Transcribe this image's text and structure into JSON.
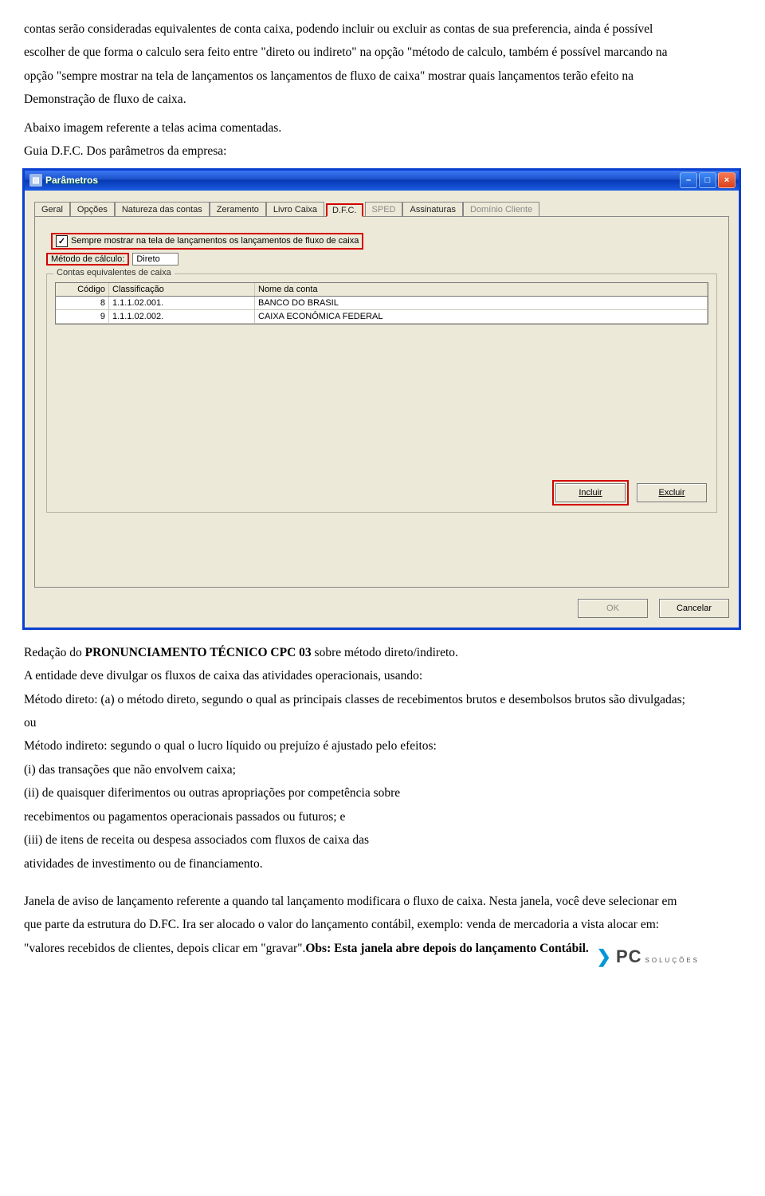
{
  "text": {
    "p1": "contas serão consideradas equivalentes de conta caixa, podendo incluir ou excluir as contas de sua preferencia, ainda é possível escolher de que forma o calculo sera feito entre \"direto ou indireto\" na opção \"método de calculo, também é possível marcando na opção \"sempre mostrar na tela  de lançamentos os lançamentos de fluxo de caixa\" mostrar quais lançamentos terão efeito na Demonstração de fluxo de caixa.",
    "p2": "Abaixo imagem referente a telas acima comentadas.",
    "p3": "Guia D.F.C. Dos parâmetros da empresa:",
    "p4a": "Redação do ",
    "p4b": "PRONUNCIAMENTO TÉCNICO CPC 03",
    "p4c": " sobre método direto/indireto.",
    "p5": "A entidade deve divulgar os fluxos de caixa das atividades operacionais, usando:",
    "p6": "Método direto: (a) o método direto, segundo o qual as principais classes de recebimentos brutos e desembolsos brutos são divulgadas; ou",
    "p7": "Método indireto: segundo o qual o lucro líquido ou prejuízo é ajustado pelo efeitos:",
    "p8": "(i) das transações que não envolvem caixa;",
    "p9": "(ii) de quaisquer diferimentos ou outras apropriações por competência sobre",
    "p10": "recebimentos ou pagamentos operacionais passados ou futuros; e",
    "p11": "(iii) de itens de receita ou despesa associados com fluxos de caixa das",
    "p12": "atividades de investimento ou de financiamento.",
    "p13": "Janela de aviso de lançamento referente a quando tal lançamento modificara o fluxo de caixa. Nesta janela, você deve selecionar em que parte da estrutura do D.FC. Ira ser alocado o valor do lançamento contábil, exemplo: venda de mercadoria a vista alocar em: \"valores recebidos de clientes, depois clicar em \"gravar\".",
    "p13b": "Obs: Esta janela abre depois do lançamento Contábil."
  },
  "window": {
    "title": "Parâmetros",
    "tabs": [
      "Geral",
      "Opções",
      "Natureza das contas",
      "Zeramento",
      "Livro Caixa",
      "D.F.C.",
      "SPED",
      "Assinaturas",
      "Domínio Cliente"
    ],
    "checkbox_label": "Sempre mostrar na tela de lançamentos os lançamentos de fluxo de caixa",
    "method_label": "Método de cálculo:",
    "method_value": "Direto",
    "group_title": "Contas equivalentes de caixa",
    "columns": {
      "code": "Código",
      "class": "Classificação",
      "name": "Nome da conta"
    },
    "rows": [
      {
        "code": "8",
        "class": "1.1.1.02.001.",
        "name": "BANCO DO BRASIL"
      },
      {
        "code": "9",
        "class": "1.1.1.02.002.",
        "name": "CAIXA ECONÔMICA FEDERAL"
      }
    ],
    "btn_incluir": "Incluir",
    "btn_excluir": "Excluir",
    "btn_ok": "OK",
    "btn_cancelar": "Cancelar"
  },
  "logo": {
    "brand": "PC",
    "tag": "SOLUÇÕES"
  }
}
